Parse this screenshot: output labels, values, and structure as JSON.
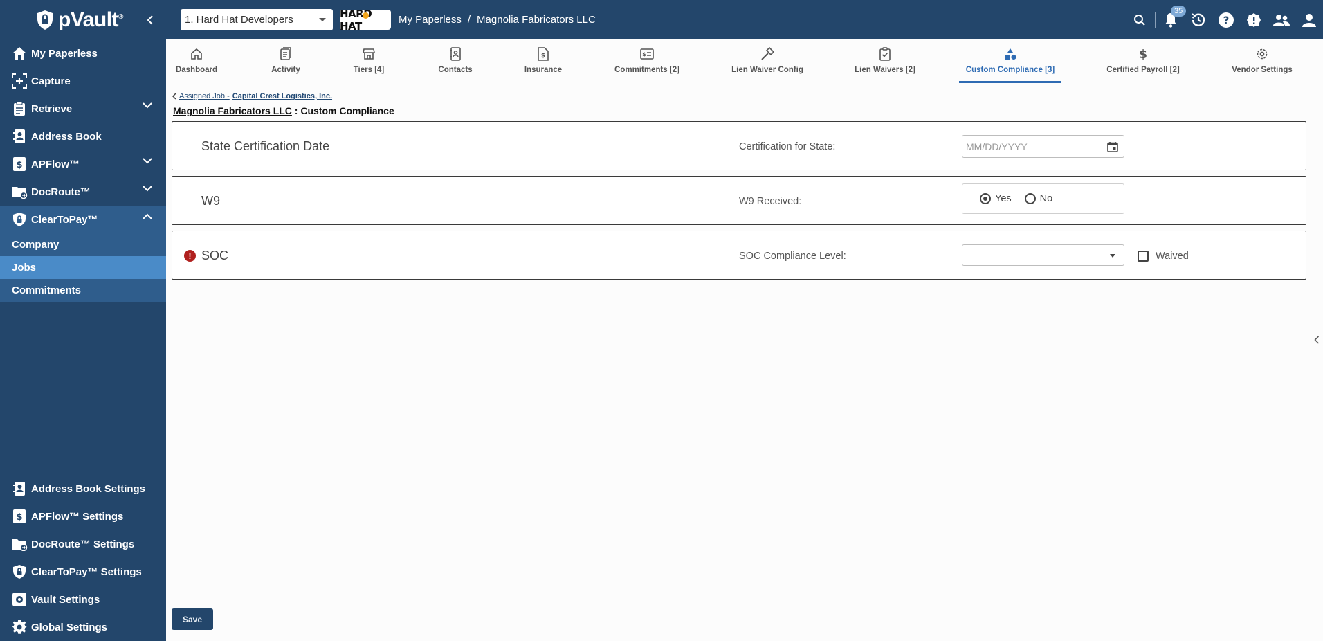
{
  "app": {
    "brand": "pVault",
    "brand_mark": "®"
  },
  "topbar": {
    "org_select_value": "1. Hard Hat Developers",
    "org_logo_text": "HARD HAT",
    "breadcrumb": [
      "My Paperless",
      "/",
      "Magnolia Fabricators LLC"
    ],
    "notifications_count": "35",
    "icons": [
      "search-icon",
      "bell-icon",
      "history-icon",
      "help-icon",
      "settings-badge-icon",
      "users-icon",
      "profile-icon"
    ]
  },
  "sidebar": {
    "items": [
      {
        "label": "My Paperless",
        "icon": "home-icon"
      },
      {
        "label": "Capture",
        "icon": "capture-icon"
      },
      {
        "label": "Retrieve",
        "icon": "clipboard-icon",
        "expandable": true
      },
      {
        "label": "Address Book",
        "icon": "address-book-icon"
      },
      {
        "label": "APFlow™",
        "icon": "dollar-doc-icon",
        "expandable": true
      },
      {
        "label": "DocRoute™",
        "icon": "folder-route-icon",
        "expandable": true
      },
      {
        "label": "ClearToPay™",
        "icon": "shield-lock-icon",
        "expanded": true
      }
    ],
    "sub_items": [
      {
        "label": "Company",
        "active": false
      },
      {
        "label": "Jobs",
        "active": true
      },
      {
        "label": "Commitments",
        "active": false
      }
    ],
    "bottom_items": [
      {
        "label": "Address Book Settings",
        "icon": "address-book-icon"
      },
      {
        "label": "APFlow™ Settings",
        "icon": "dollar-doc-icon"
      },
      {
        "label": "DocRoute™ Settings",
        "icon": "folder-route-icon"
      },
      {
        "label": "ClearToPay™ Settings",
        "icon": "shield-lock-icon"
      },
      {
        "label": "Vault Settings",
        "icon": "vault-gear-icon"
      },
      {
        "label": "Global Settings",
        "icon": "gear-icon"
      }
    ]
  },
  "tabs": [
    {
      "label": "Dashboard",
      "icon": "home-icon"
    },
    {
      "label": "Activity",
      "icon": "clipboard-icon"
    },
    {
      "label": "Tiers [4]",
      "icon": "store-icon"
    },
    {
      "label": "Contacts",
      "icon": "contacts-icon"
    },
    {
      "label": "Insurance",
      "icon": "insurance-doc-icon"
    },
    {
      "label": "Commitments [2]",
      "icon": "commitment-icon"
    },
    {
      "label": "Lien Waiver Config",
      "icon": "hammer-icon"
    },
    {
      "label": "Lien Waivers [2]",
      "icon": "clipboard-check-icon"
    },
    {
      "label": "Custom Compliance [3]",
      "icon": "shapes-icon",
      "active": true
    },
    {
      "label": "Certified Payroll [2]",
      "icon": "dollar-icon"
    },
    {
      "label": "Vendor Settings",
      "icon": "gear-icon"
    }
  ],
  "page": {
    "back_prefix": "Assigned Job - ",
    "back_job": "Capital Crest Logistics, Inc.",
    "company": "Magnolia Fabricators LLC",
    "title_sep": " : ",
    "title": "Custom Compliance"
  },
  "compliance": {
    "state_cert": {
      "title": "State Certification Date",
      "label": "Certification for State:",
      "placeholder": "MM/DD/YYYY"
    },
    "w9": {
      "title": "W9",
      "label": "W9 Received:",
      "yes": "Yes",
      "no": "No",
      "selected": "Yes"
    },
    "soc": {
      "title": "SOC",
      "label": "SOC Compliance Level:",
      "value": "",
      "waived_label": "Waived",
      "waived": false,
      "warning": "!"
    }
  },
  "footer": {
    "save_label": "Save"
  },
  "colors": {
    "nav_bg": "#23466b",
    "sub_bg": "#2f5d8c",
    "active_sub": "#4a8bc8",
    "accent": "#2e6bb3",
    "warning": "#b0201e"
  }
}
